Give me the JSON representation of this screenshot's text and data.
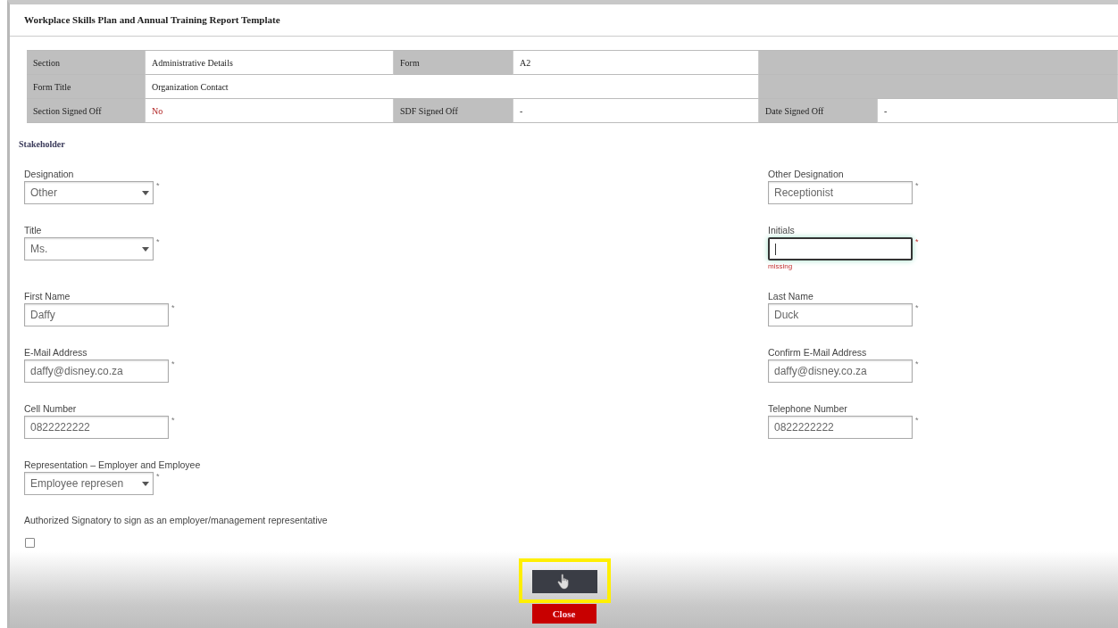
{
  "window": {
    "title": "Workplace Skills Plan and Annual Training Report Template"
  },
  "info_table": {
    "rows": [
      [
        {
          "kind": "label",
          "text": "Section"
        },
        {
          "kind": "value",
          "text": "Administrative Details"
        },
        {
          "kind": "label",
          "text": "Form"
        },
        {
          "kind": "value",
          "text": "A2"
        },
        {
          "kind": "blank"
        }
      ],
      [
        {
          "kind": "label",
          "text": "Form Title"
        },
        {
          "kind": "value",
          "text": "Organization Contact"
        },
        {
          "kind": "blank"
        }
      ],
      [
        {
          "kind": "label",
          "text": "Section Signed Off"
        },
        {
          "kind": "warning",
          "text": "No"
        },
        {
          "kind": "label",
          "text": "SDF Signed Off"
        },
        {
          "kind": "value",
          "text": "-"
        },
        {
          "kind": "label",
          "text": "Date Signed Off"
        },
        {
          "kind": "value",
          "text": "-"
        }
      ]
    ]
  },
  "form": {
    "heading": "Stakeholder",
    "rows": [
      [
        {
          "label": "Designation",
          "kind": "select",
          "value": "Other",
          "marker": "*",
          "invalid": false
        },
        {
          "label": "Other Designation",
          "kind": "text",
          "value": "Receptionist",
          "marker": "*",
          "invalid": false
        }
      ],
      [
        {
          "label": "Title",
          "kind": "select",
          "value": "Ms.",
          "marker": "*",
          "invalid": false
        },
        {
          "label": "Initials",
          "kind": "text",
          "marker": "*",
          "invalid": true,
          "error": "missing"
        }
      ],
      [
        {
          "label": "First Name",
          "kind": "text",
          "value": "Daffy",
          "marker": "*",
          "invalid": false
        },
        {
          "label": "Last Name",
          "kind": "text",
          "value": "Duck",
          "marker": "*",
          "invalid": false
        }
      ],
      [
        {
          "label": "E-Mail Address",
          "kind": "text",
          "value": "daffy@disney.co.za",
          "marker": "*",
          "invalid": false
        },
        {
          "label": "Confirm E-Mail Address",
          "kind": "text",
          "value": "daffy@disney.co.za",
          "marker": "*",
          "invalid": false
        }
      ],
      [
        {
          "label": "Cell Number",
          "kind": "text",
          "value": "0822222222",
          "marker": "*",
          "invalid": false
        },
        {
          "label": "Telephone Number",
          "kind": "text",
          "value": "0822222222",
          "marker": "*",
          "invalid": false
        }
      ],
      [
        {
          "label": "Representation – Employer and Employee",
          "kind": "select",
          "value": "Employee represen",
          "marker": "*",
          "invalid": false
        }
      ]
    ],
    "signatory": {
      "label": "Authorized Signatory to sign as an employer/management representative",
      "checked": false
    }
  },
  "actions": {
    "close": "Close",
    "highlighted": true
  }
}
